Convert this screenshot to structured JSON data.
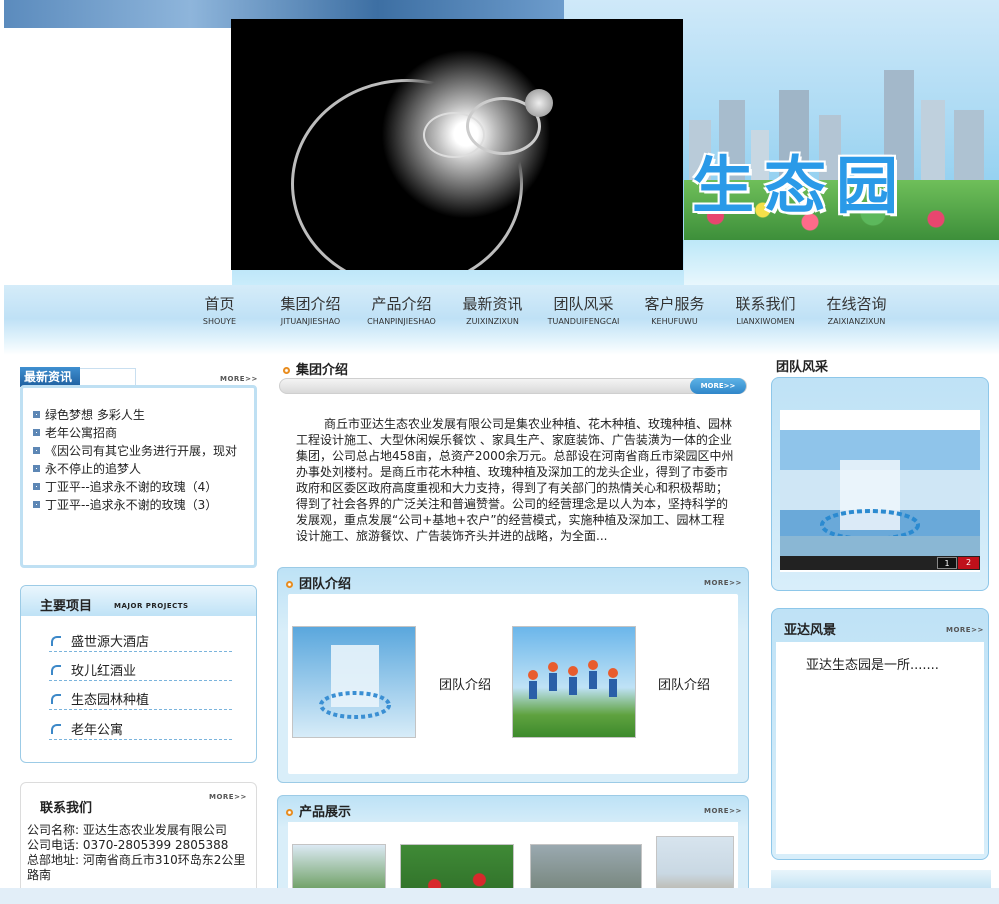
{
  "header": {
    "banner_title": "生态园"
  },
  "nav": [
    {
      "zh": "首页",
      "py": "SHOUYE"
    },
    {
      "zh": "集团介绍",
      "py": "JITUANJIESHAO"
    },
    {
      "zh": "产品介绍",
      "py": "CHANPINJIESHAO"
    },
    {
      "zh": "最新资讯",
      "py": "ZUIXINZIXUN"
    },
    {
      "zh": "团队风采",
      "py": "TUANDUIFENGCAI"
    },
    {
      "zh": "客户服务",
      "py": "KEHUFUWU"
    },
    {
      "zh": "联系我们",
      "py": "LIANXIWOMEN"
    },
    {
      "zh": "在线咨询",
      "py": "ZAIXIANZIXUN"
    }
  ],
  "more_label": "MORE>>",
  "news": {
    "title": "最新资讯",
    "items": [
      "绿色梦想 多彩人生",
      "老年公寓招商",
      "《因公司有其它业务进行开展，现对",
      "永不停止的追梦人",
      "丁亚平--追求永不谢的玫瑰（4）",
      "丁亚平--追求永不谢的玫瑰（3）"
    ]
  },
  "projects": {
    "title": "主要项目",
    "subtitle": "MAJOR PROJECTS",
    "items": [
      "盛世源大酒店",
      "玫儿红酒业",
      "生态园林种植",
      "老年公寓"
    ]
  },
  "contact": {
    "title": "联系我们",
    "company": "公司名称: 亚达生态农业发展有限公司",
    "phone": "公司电话: 0370-2805399 2805388",
    "address": "总部地址: 河南省商丘市310环岛东2公里路南"
  },
  "about": {
    "title": "集团介绍",
    "text": "商丘市亚达生态农业发展有限公司是集农业种植、花木种植、玫瑰种植、园林工程设计施工、大型休闲娱乐餐饮 、家具生产、家庭装饰、广告装潢为一体的企业集团，公司总占地458亩，总资产2000余万元。总部设在河南省商丘市梁园区中州办事处刘楼村。是商丘市花木种植、玫瑰种植及深加工的龙头企业，得到了市委市政府和区委区政府高度重视和大力支持，得到了有关部门的热情关心和积极帮助；得到了社会各界的广泛关注和普遍赞誉。公司的经营理念是以人为本，坚持科学的发展观，重点发展“公司+基地+农户”的经营模式，实施种植及深加工、园林工程设计施工、旅游餐饮、广告装饰齐头并进的战略，为全面..."
  },
  "team": {
    "title": "团队介绍",
    "captions": [
      "团队介绍",
      "团队介绍"
    ]
  },
  "products": {
    "title": "产品展示"
  },
  "team_style": {
    "title": "团队风采",
    "pager": [
      "1",
      "2"
    ]
  },
  "scenery": {
    "title": "亚达风景",
    "text": "亚达生态园是一所......."
  }
}
